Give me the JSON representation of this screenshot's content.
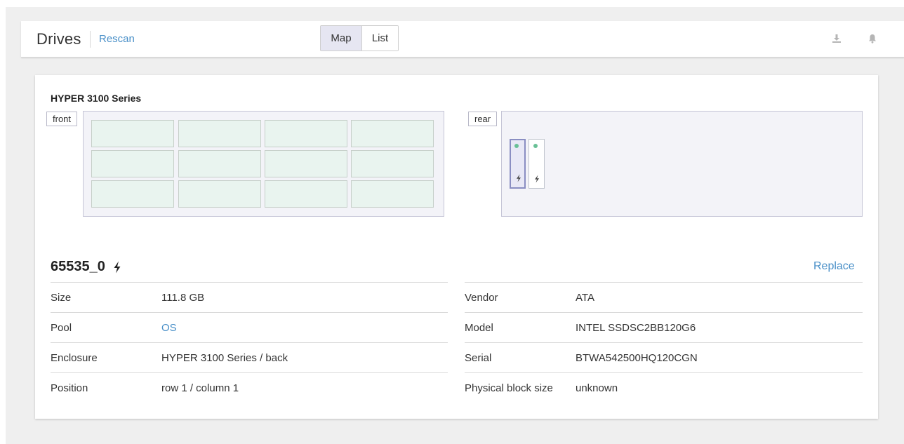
{
  "header": {
    "title": "Drives",
    "rescan_label": "Rescan",
    "view_toggle": {
      "map_label": "Map",
      "list_label": "List",
      "selected": "Map"
    },
    "icons": [
      "download-icon",
      "bell-icon"
    ]
  },
  "enclosure": {
    "name": "HYPER 3100 Series",
    "front_label": "front",
    "rear_label": "rear",
    "front_slots": {
      "rows": 3,
      "columns": 4
    },
    "rear_drives": [
      {
        "status_color": "#68c096",
        "icon": "bolt-icon",
        "selected": true
      },
      {
        "status_color": "#68c096",
        "icon": "bolt-icon",
        "selected": false
      }
    ]
  },
  "drive": {
    "name": "65535_0",
    "icon": "bolt-icon",
    "replace_label": "Replace",
    "left_details": [
      {
        "label": "Size",
        "value": "111.8 GB"
      },
      {
        "label": "Pool",
        "value": "OS"
      },
      {
        "label": "Enclosure",
        "value": "HYPER 3100 Series / back"
      },
      {
        "label": "Position",
        "value": "row 1 / column 1"
      }
    ],
    "right_details": [
      {
        "label": "Vendor",
        "value": "ATA"
      },
      {
        "label": "Model",
        "value": "INTEL SSDSC2BB120G6"
      },
      {
        "label": "Serial",
        "value": "BTWA542500HQ120CGN"
      },
      {
        "label": "Physical block size",
        "value": "unknown"
      }
    ]
  },
  "colors": {
    "accent_link": "#4a90c8",
    "slot_fill": "#e9f4ef",
    "status_dot": "#68c096",
    "selected_drive_border": "#8a8ec2"
  }
}
